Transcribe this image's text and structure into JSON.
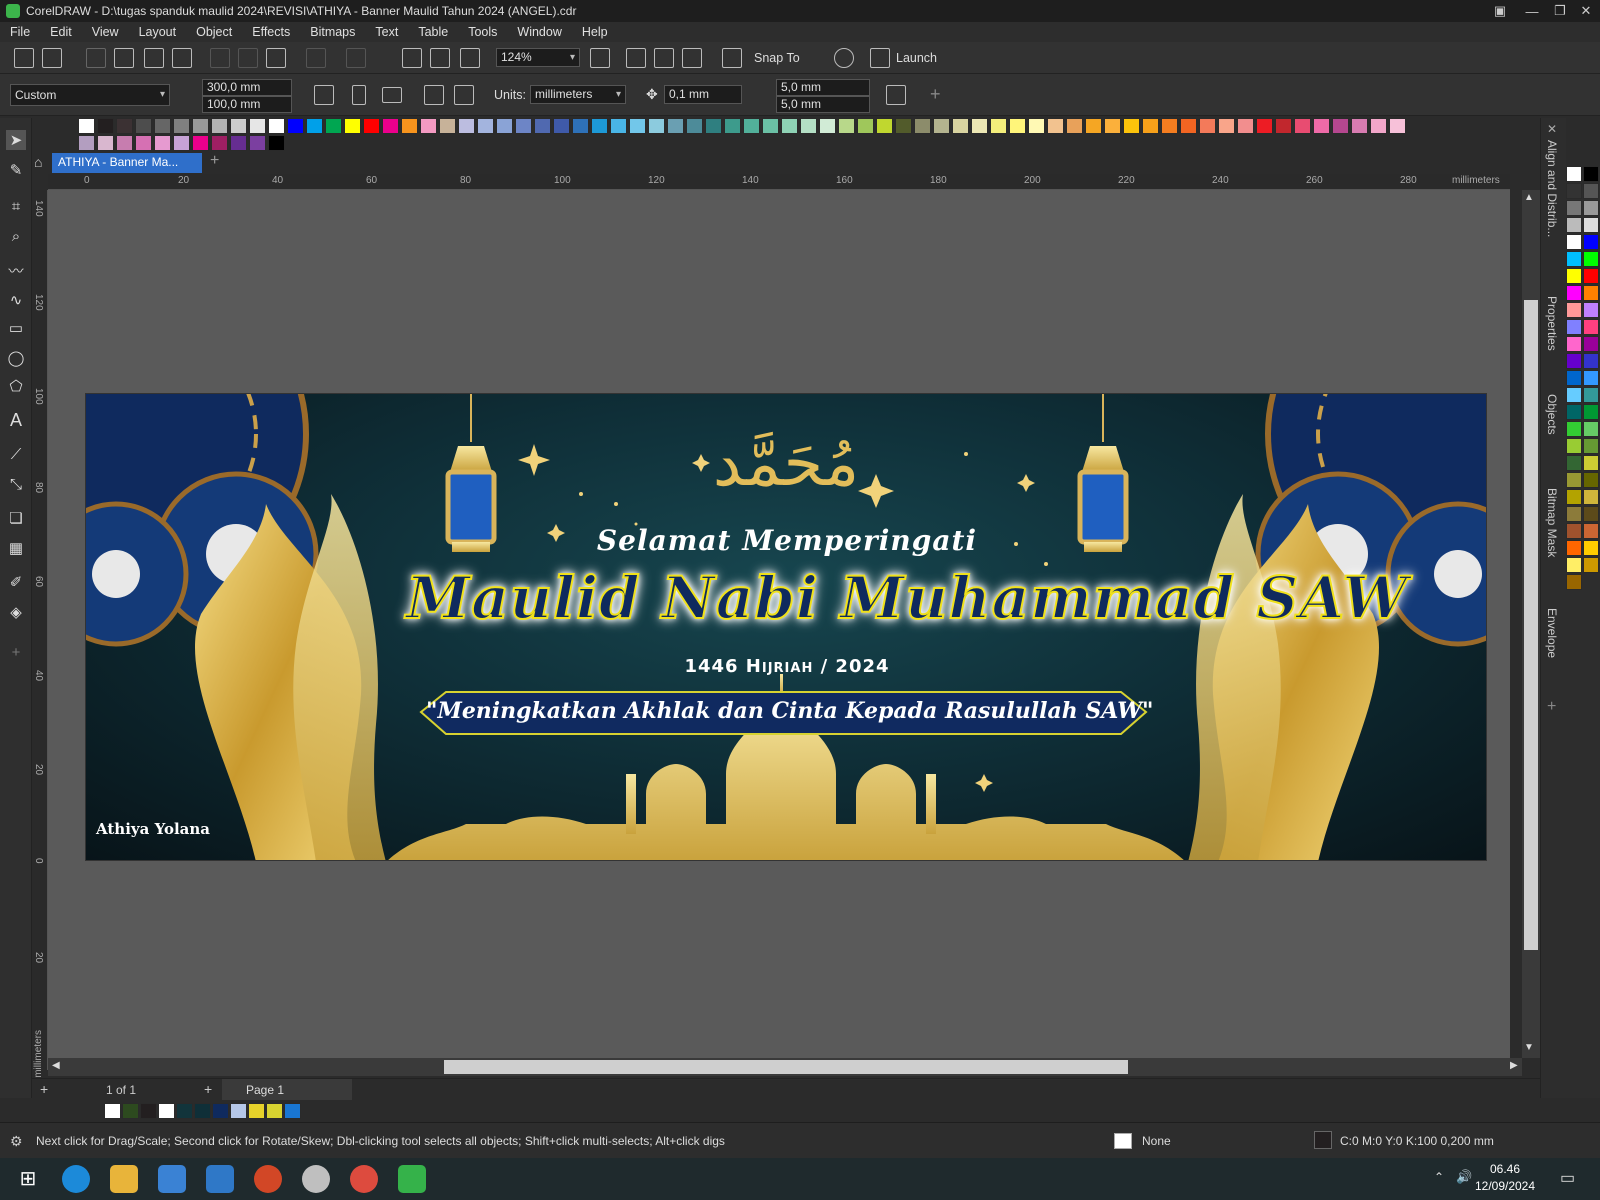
{
  "window": {
    "title": "CorelDRAW - D:\\tugas spanduk maulid 2024\\REVISI\\ATHIYA - Banner Maulid Tahun 2024 (ANGEL).cdr"
  },
  "menu": [
    "File",
    "Edit",
    "View",
    "Layout",
    "Object",
    "Effects",
    "Bitmaps",
    "Text",
    "Table",
    "Tools",
    "Window",
    "Help"
  ],
  "toolbar": {
    "zoom": "124%",
    "snap_to": "Snap To",
    "launch": "Launch"
  },
  "property_bar": {
    "page_size": "Custom",
    "width": "300,0 mm",
    "height": "100,0 mm",
    "units_label": "Units:",
    "units": "millimeters",
    "nudge": "0,1 mm",
    "dup_x": "5,0 mm",
    "dup_y": "5,0 mm"
  },
  "tabs": {
    "document": "ATHIYA - Banner Ma..."
  },
  "rulers": {
    "h_unit": "millimeters",
    "h_ticks": [
      "0",
      "20",
      "40",
      "60",
      "80",
      "100",
      "120",
      "140",
      "160",
      "180",
      "200",
      "220",
      "240",
      "260",
      "280"
    ],
    "v_ticks": [
      "140",
      "120",
      "100",
      "80",
      "60",
      "40",
      "20",
      "0",
      "20"
    ],
    "v_unit": "millimeters"
  },
  "banner": {
    "arabic": "مُحَمَّد",
    "line1": "Selamat Memperingati",
    "line2": "Maulid Nabi Muhammad SAW",
    "line3": "1446 Hijriah / 2024",
    "quote": "\"Meningkatkan Akhlak dan Cinta Kepada Rasulullah SAW\"",
    "author": "Athiya Yolana"
  },
  "pagebar": {
    "counter": "1 of 1",
    "page_tab": "Page 1"
  },
  "status": {
    "hint": "Next click for Drag/Scale; Second click for Rotate/Skew; Dbl-clicking tool selects all objects; Shift+click multi-selects; Alt+click digs",
    "fill": "None",
    "outline": "C:0 M:0 Y:0 K:100  0,200 mm"
  },
  "dockers": [
    "Align and Distrib...",
    "Properties",
    "Objects",
    "Bitmap Mask",
    "Envelope"
  ],
  "taskbar": {
    "time": "06.46",
    "date": "12/09/2024"
  },
  "colors": {
    "accent": "#2f6fca",
    "gold": "#e0b84a",
    "navy": "#0f2a5e"
  }
}
